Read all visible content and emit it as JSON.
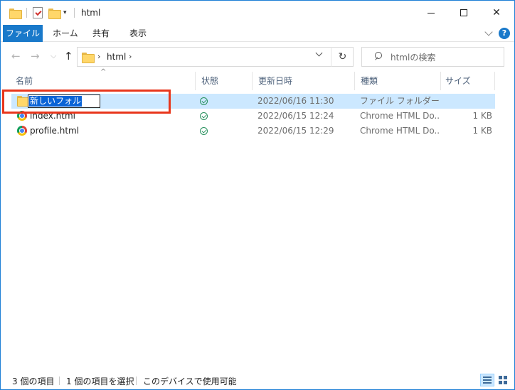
{
  "window": {
    "title": "html",
    "controls": {
      "minimize_icon": "minimize-icon",
      "maximize_icon": "maximize-icon",
      "close_glyph": "✕"
    }
  },
  "ribbon": {
    "tabs": [
      {
        "label": "ファイル",
        "active": true
      },
      {
        "label": "ホーム"
      },
      {
        "label": "共有"
      },
      {
        "label": "表示"
      }
    ],
    "help_label": "?"
  },
  "navigation": {
    "back_glyph": "←",
    "forward_glyph": "→",
    "recent_glyph": "⌵",
    "up_glyph": "↑",
    "breadcrumb": [
      "html"
    ],
    "refresh_glyph": "↻",
    "search_placeholder": "htmlの検索"
  },
  "columns": [
    {
      "label": "名前"
    },
    {
      "label": "状態"
    },
    {
      "label": "更新日時"
    },
    {
      "label": "種類"
    },
    {
      "label": "サイズ"
    }
  ],
  "sort_indicator": "^",
  "files": [
    {
      "name": "新しいフォルダー",
      "status": "synced",
      "modified": "2022/06/16 11:30",
      "type": "ファイル フォルダー",
      "size": "",
      "icon": "folder-icon",
      "selected": true,
      "renaming": true
    },
    {
      "name": "index.html",
      "status": "synced",
      "modified": "2022/06/15 12:24",
      "type": "Chrome HTML Do...",
      "size": "1 KB",
      "icon": "chrome-icon"
    },
    {
      "name": "profile.html",
      "status": "synced",
      "modified": "2022/06/15 12:29",
      "type": "Chrome HTML Do...",
      "size": "1 KB",
      "icon": "chrome-icon"
    }
  ],
  "status_bar": {
    "item_count": "3 個の項目",
    "selected_count": "1 個の項目を選択",
    "availability": "このデバイスで使用可能"
  },
  "colors": {
    "accent": "#1979ca",
    "selection": "#cce8ff",
    "highlight_border": "#e8361c",
    "status_ok": "#27905d"
  }
}
